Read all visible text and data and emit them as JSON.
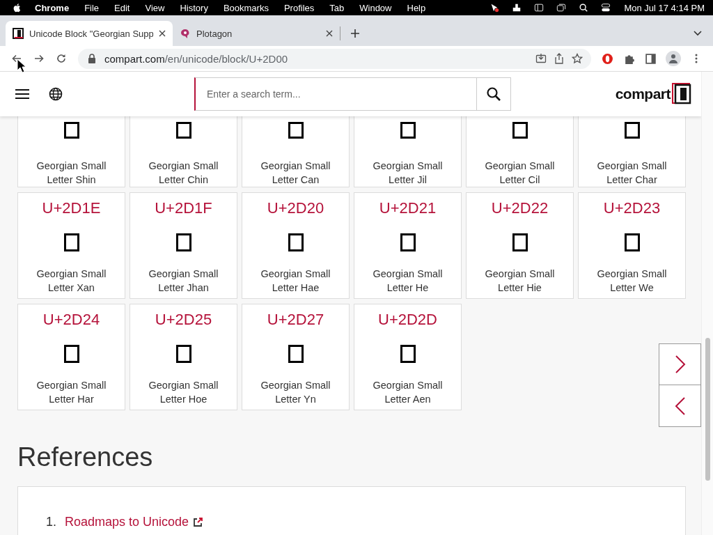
{
  "menubar": {
    "app": "Chrome",
    "menus": [
      "File",
      "Edit",
      "View",
      "History",
      "Bookmarks",
      "Profiles",
      "Tab",
      "Window",
      "Help"
    ],
    "clock": "Mon Jul 17  4:14 PM"
  },
  "tabs": [
    {
      "title": "Unicode Block \"Georgian Supp",
      "selected": true,
      "kind": "compart"
    },
    {
      "title": "Plotagon",
      "selected": false,
      "kind": "plotagon"
    }
  ],
  "address": {
    "host": "compart.com",
    "path": "/en/unicode/block/U+2D00"
  },
  "header": {
    "search_placeholder": "Enter a search term...",
    "logo": "compart"
  },
  "characters": [
    {
      "name": "Georgian Small Letter Shin"
    },
    {
      "name": "Georgian Small Letter Chin"
    },
    {
      "name": "Georgian Small Letter Can"
    },
    {
      "name": "Georgian Small Letter Jil"
    },
    {
      "name": "Georgian Small Letter Cil"
    },
    {
      "name": "Georgian Small Letter Char"
    },
    {
      "code": "U+2D1E",
      "name": "Georgian Small Letter Xan"
    },
    {
      "code": "U+2D1F",
      "name": "Georgian Small Letter Jhan"
    },
    {
      "code": "U+2D20",
      "name": "Georgian Small Letter Hae"
    },
    {
      "code": "U+2D21",
      "name": "Georgian Small Letter He"
    },
    {
      "code": "U+2D22",
      "name": "Georgian Small Letter Hie"
    },
    {
      "code": "U+2D23",
      "name": "Georgian Small Letter We"
    },
    {
      "code": "U+2D24",
      "name": "Georgian Small Letter Har"
    },
    {
      "code": "U+2D25",
      "name": "Georgian Small Letter Hoe"
    },
    {
      "code": "U+2D27",
      "name": "Georgian Small Letter Yn"
    },
    {
      "code": "U+2D2D",
      "name": "Georgian Small Letter Aen"
    }
  ],
  "references": {
    "title": "References",
    "items": [
      {
        "number": "1.",
        "link": "Roadmaps to Unicode"
      }
    ]
  }
}
